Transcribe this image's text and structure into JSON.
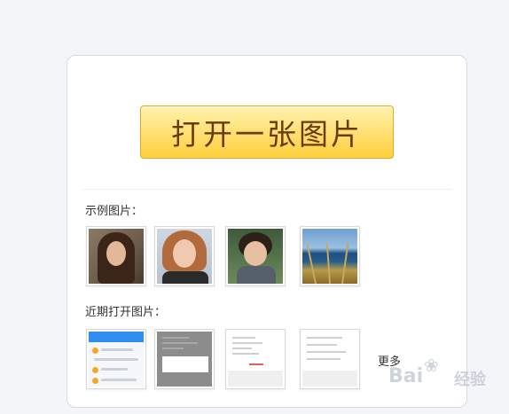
{
  "dialog": {
    "open_button_label": "打开一张图片",
    "sample_label": "示例图片：",
    "recent_label": "近期打开图片：",
    "more_label": "更多",
    "sample_images": [
      {
        "name": "portrait-woman-long-hair"
      },
      {
        "name": "portrait-woman-auburn-hair"
      },
      {
        "name": "portrait-child-curly-hair"
      },
      {
        "name": "seaside-grass"
      }
    ],
    "recent_images": [
      {
        "name": "chat-app-screenshot"
      },
      {
        "name": "dialog-screenshot"
      },
      {
        "name": "form-screenshot"
      },
      {
        "name": "message-screenshot"
      }
    ]
  },
  "watermark": {
    "text": "Bai 经验",
    "url": "jingyan.baidu.com"
  },
  "colors": {
    "button_top": "#fff3b0",
    "button_bottom": "#ffcf3e",
    "button_text": "#6b3a10",
    "panel_border": "#d6dae4"
  }
}
